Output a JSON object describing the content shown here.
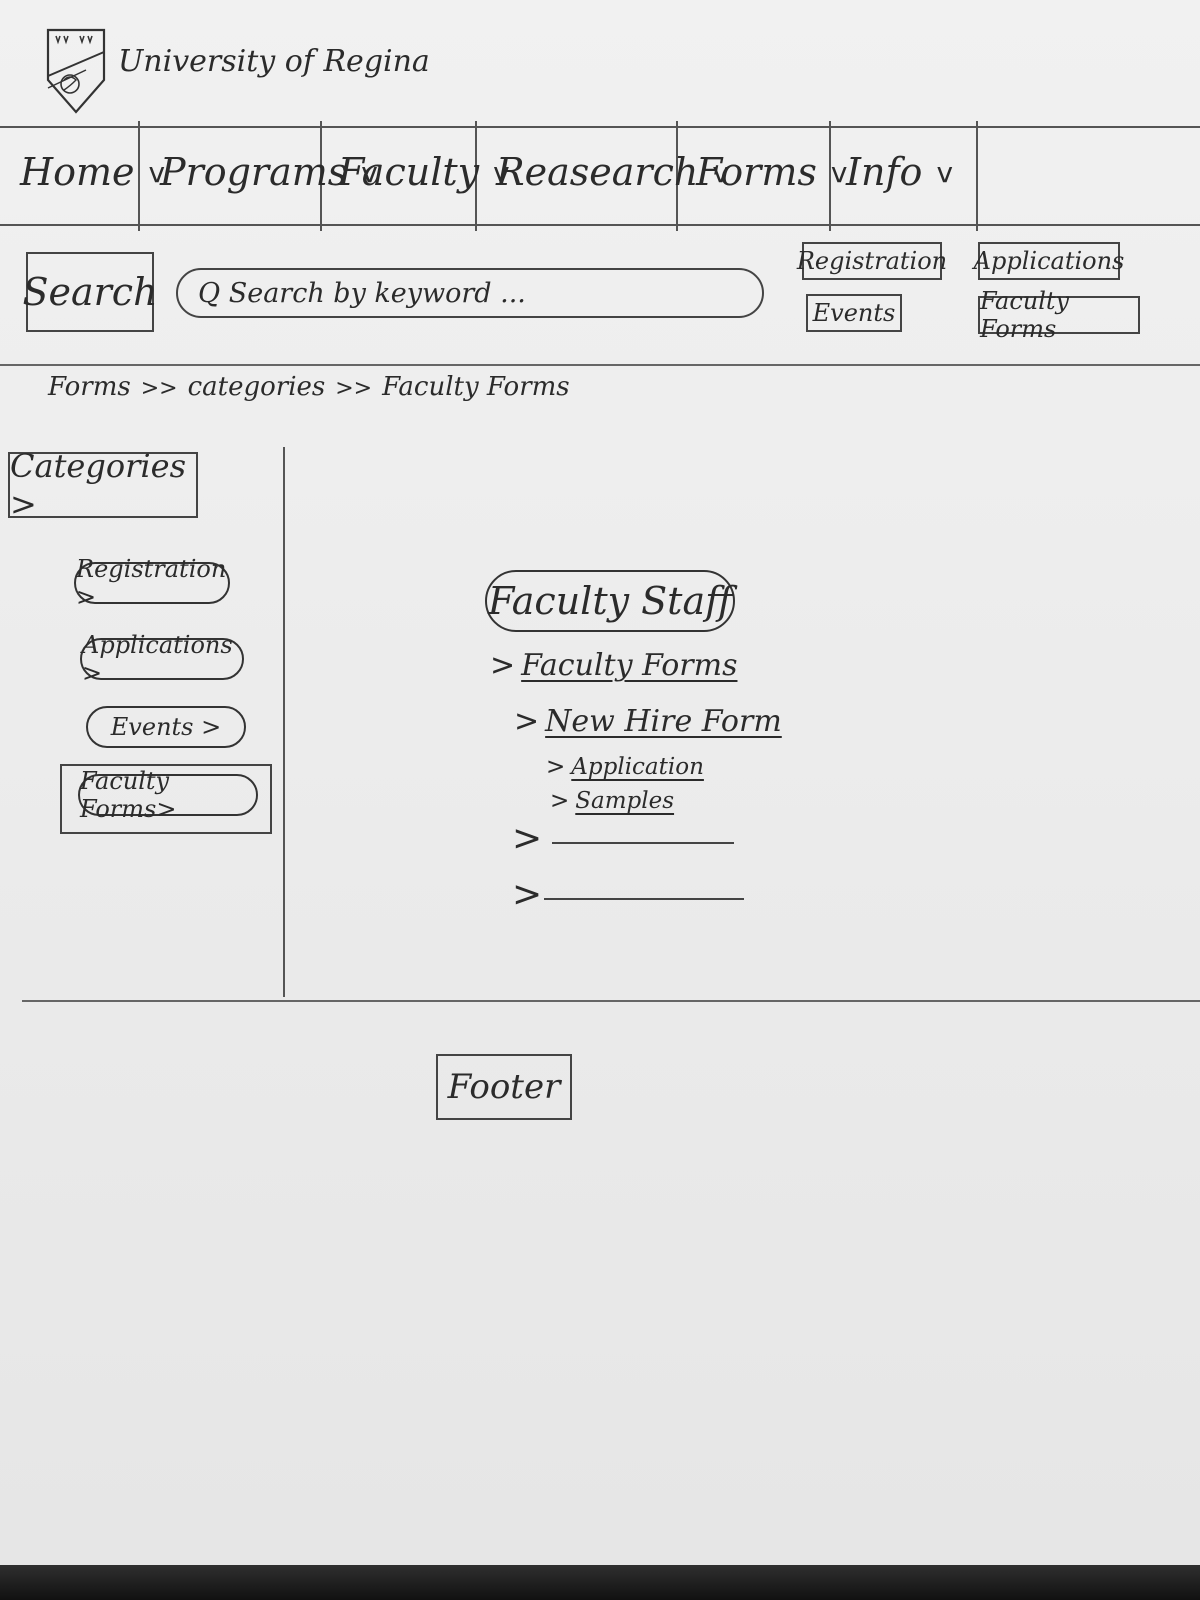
{
  "header": {
    "site_title": "University of Regina"
  },
  "nav": {
    "items": [
      {
        "label": "Home"
      },
      {
        "label": "Programs"
      },
      {
        "label": "Faculty"
      },
      {
        "label": "Reasearch"
      },
      {
        "label": "Forms"
      },
      {
        "label": "Info"
      }
    ],
    "chevron": "v"
  },
  "search": {
    "button_label": "Search",
    "placeholder": "Q Search by keyword ..."
  },
  "quick_links": {
    "registration": "Registration",
    "applications": "Applications",
    "events": "Events",
    "faculty_forms": "Faculty Forms"
  },
  "breadcrumb": {
    "items": [
      "Forms",
      "categories",
      "Faculty Forms"
    ],
    "separator": ">>"
  },
  "sidebar": {
    "header": "Categories >",
    "items": [
      {
        "label": "Registration >"
      },
      {
        "label": "Applications >"
      },
      {
        "label": "Events >"
      },
      {
        "label": "Faculty Forms>"
      }
    ]
  },
  "main": {
    "section_title": "Faculty Staff",
    "tree": [
      {
        "label": "Faculty Forms"
      },
      {
        "label": "New Hire Form"
      },
      {
        "label": "Application"
      },
      {
        "label": "Samples"
      }
    ],
    "arrow": ">"
  },
  "footer": {
    "label": "Footer"
  }
}
